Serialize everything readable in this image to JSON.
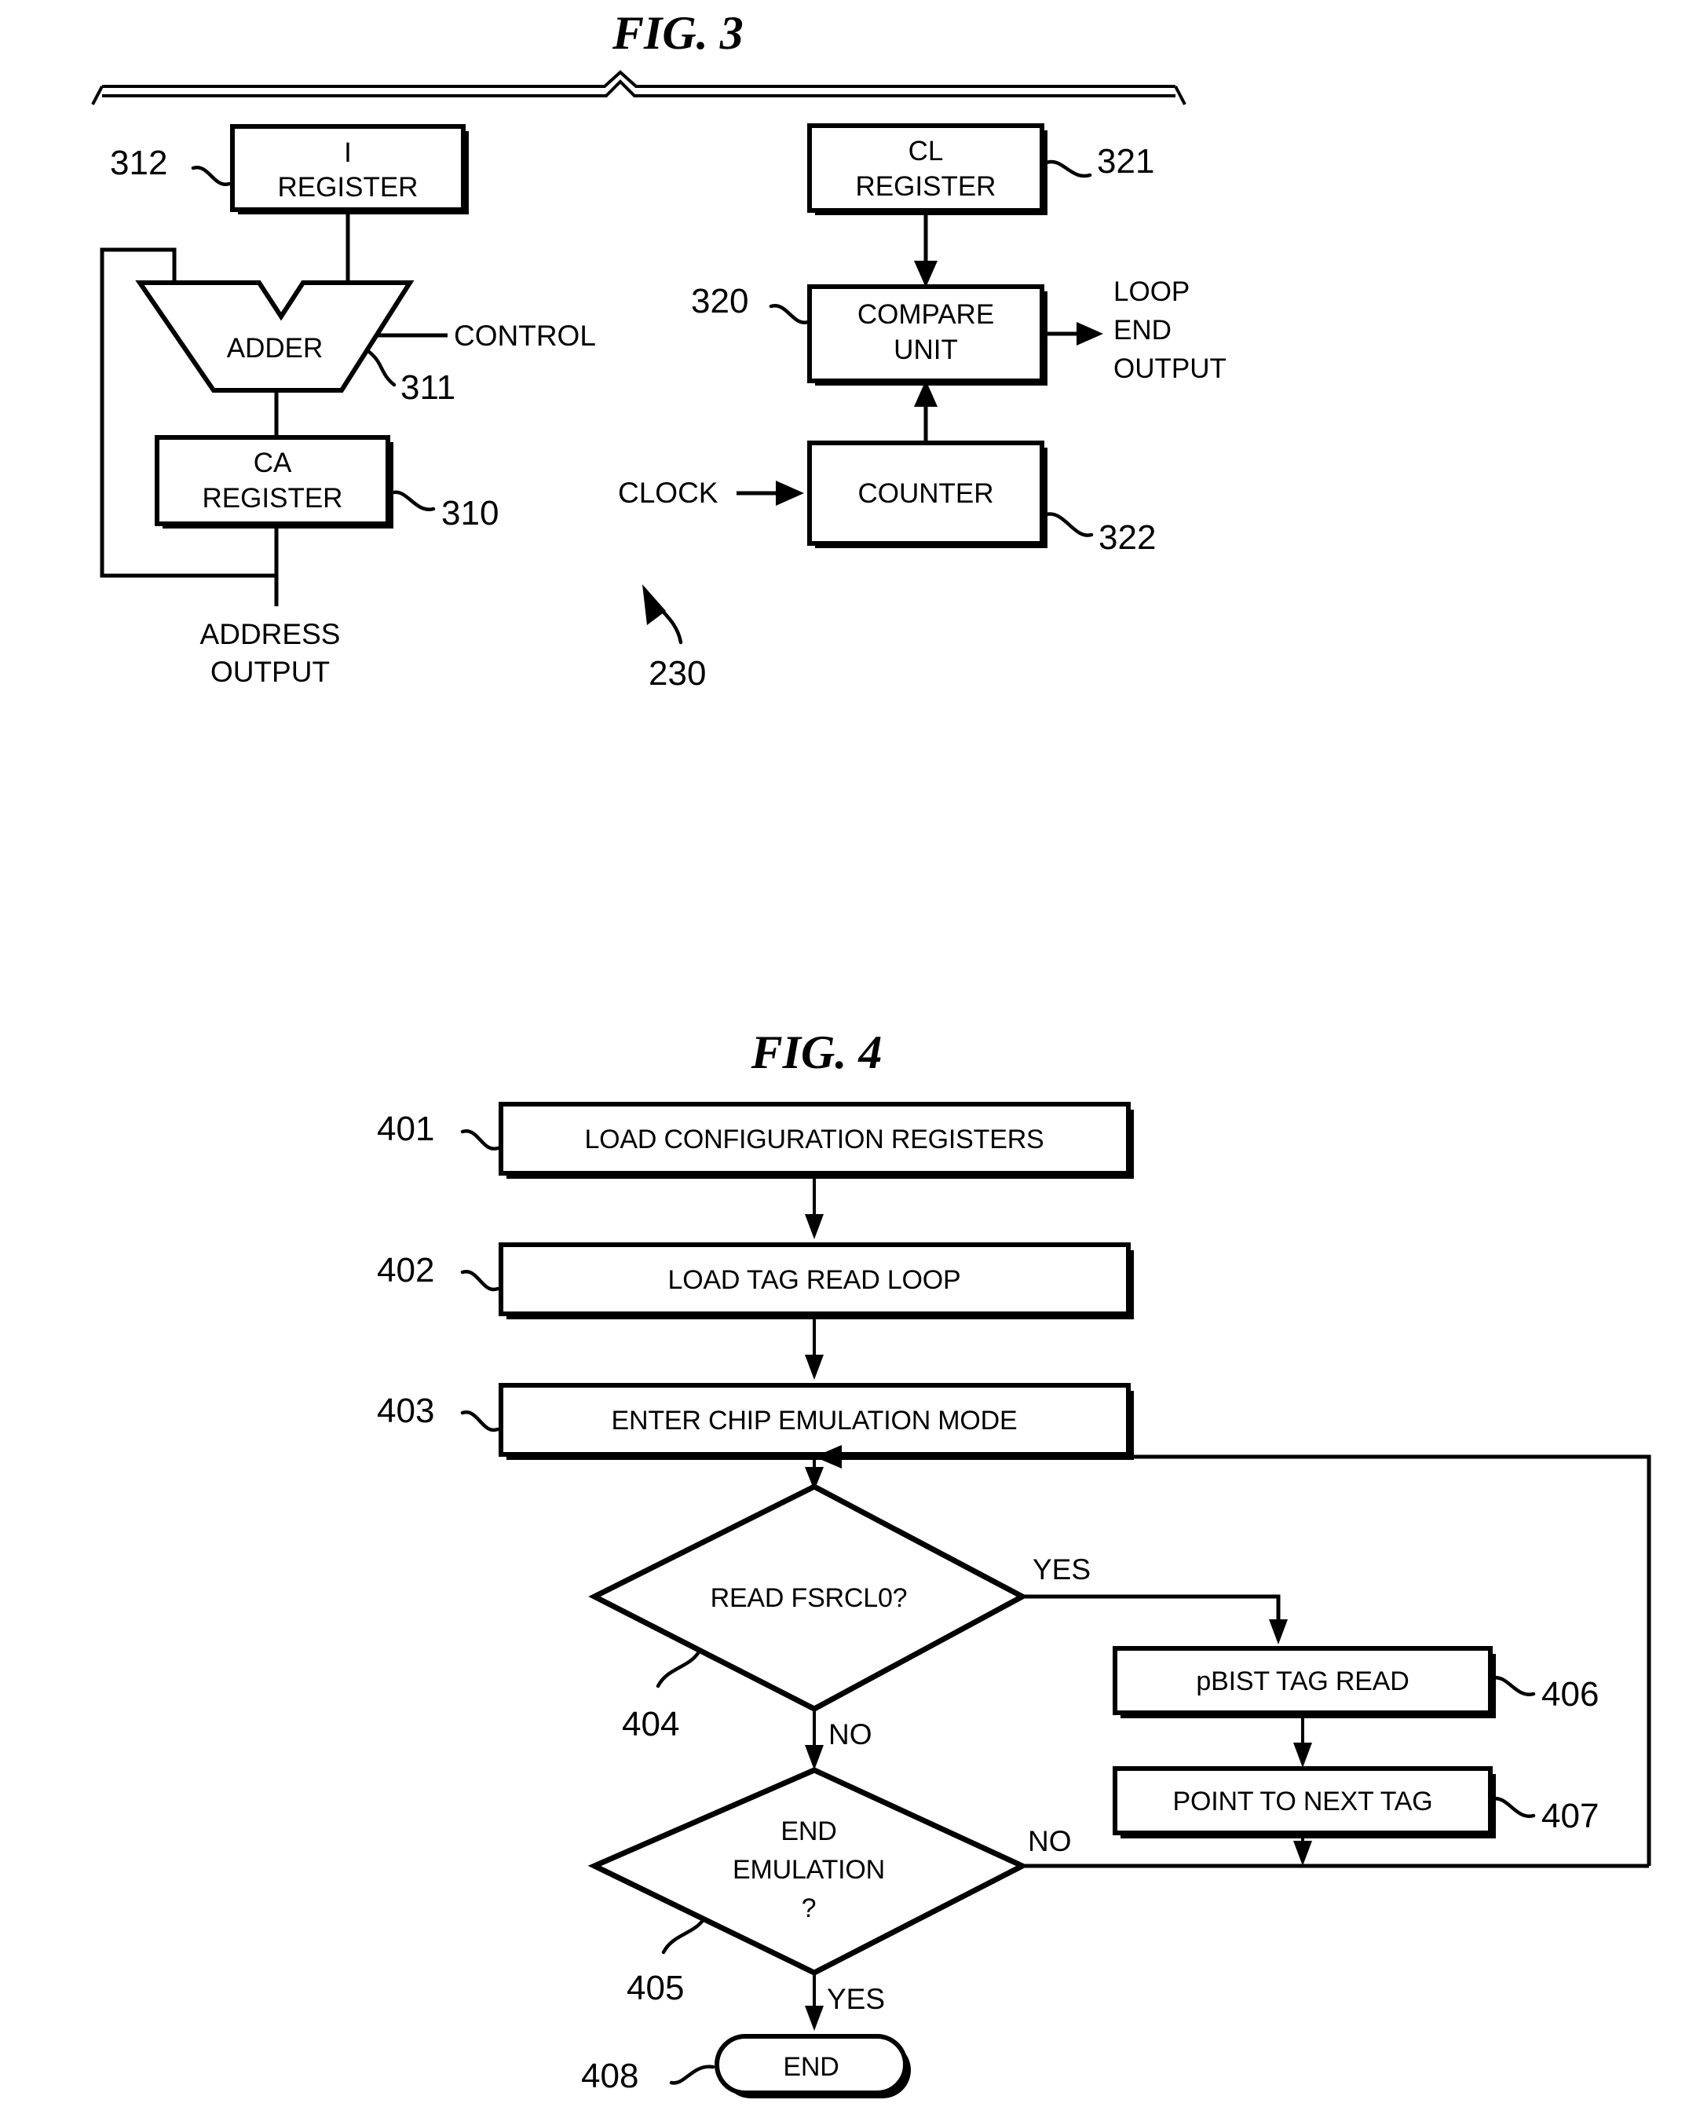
{
  "sheet": {
    "background": "#ffffff",
    "ink": "#000000"
  },
  "fig3": {
    "title": "FIG. 3",
    "overall_ref": "230",
    "blocks": {
      "i_register": {
        "line1": "I",
        "line2": "REGISTER",
        "ref": "312"
      },
      "adder": {
        "label": "ADDER",
        "ref": "311"
      },
      "ca_register": {
        "line1": "CA",
        "line2": "REGISTER",
        "ref": "310"
      },
      "cl_register": {
        "line1": "CL",
        "line2": "REGISTER",
        "ref": "321"
      },
      "compare_unit": {
        "line1": "COMPARE",
        "line2": "UNIT",
        "ref": "320"
      },
      "counter": {
        "label": "COUNTER",
        "ref": "322"
      }
    },
    "signals": {
      "control": "CONTROL",
      "address_output_line1": "ADDRESS",
      "address_output_line2": "OUTPUT",
      "clock": "CLOCK",
      "loop_end_output_line1": "LOOP",
      "loop_end_output_line2": "END",
      "loop_end_output_line3": "OUTPUT"
    }
  },
  "fig4": {
    "title": "FIG. 4",
    "steps": [
      {
        "ref": "401",
        "label": "LOAD CONFIGURATION REGISTERS",
        "shape": "process"
      },
      {
        "ref": "402",
        "label": "LOAD TAG READ LOOP",
        "shape": "process"
      },
      {
        "ref": "403",
        "label": "ENTER CHIP EMULATION MODE",
        "shape": "process"
      },
      {
        "ref": "404",
        "label": "READ FSRCL0?",
        "shape": "decision"
      },
      {
        "ref": "405",
        "label_line1": "END",
        "label_line2": "EMULATION",
        "label_line3": "?",
        "shape": "decision"
      },
      {
        "ref": "406",
        "label": "pBIST TAG READ",
        "shape": "process"
      },
      {
        "ref": "407",
        "label": "POINT TO NEXT TAG",
        "shape": "process"
      },
      {
        "ref": "408",
        "label": "END",
        "shape": "terminator"
      }
    ],
    "branch_labels": {
      "d404_yes": "YES",
      "d404_no": "NO",
      "d405_no": "NO",
      "d405_yes": "YES"
    }
  }
}
